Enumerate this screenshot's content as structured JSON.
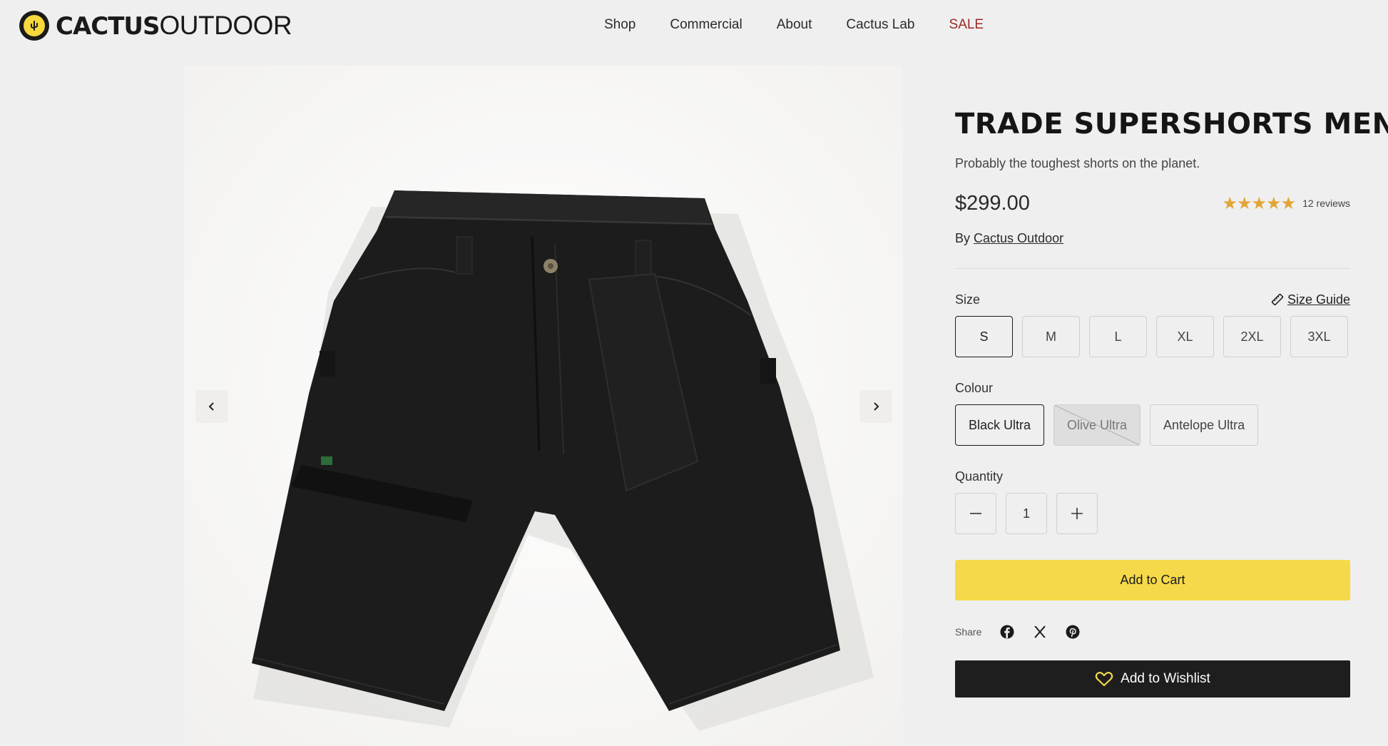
{
  "brand": {
    "bold": "CACTUS",
    "thin": "OUTDOOR"
  },
  "nav": {
    "shop": "Shop",
    "commercial": "Commercial",
    "about": "About",
    "lab": "Cactus Lab",
    "sale": "SALE"
  },
  "product": {
    "title": "TRADE SUPERSHORTS MENS",
    "subtitle": "Probably the toughest shorts on the planet.",
    "price": "$299.00",
    "stars": "★★★★★",
    "rating": 5,
    "reviews": "12 reviews",
    "by_prefix": "By",
    "brand_link": "Cactus Outdoor"
  },
  "size": {
    "label": "Size",
    "guide": "Size Guide",
    "options": [
      "S",
      "M",
      "L",
      "XL",
      "2XL",
      "3XL"
    ],
    "selected": "S"
  },
  "colour": {
    "label": "Colour",
    "options": [
      "Black Ultra",
      "Olive Ultra",
      "Antelope Ultra"
    ],
    "selected": "Black Ultra",
    "unavailable": [
      "Olive Ultra"
    ]
  },
  "quantity": {
    "label": "Quantity",
    "value": "1"
  },
  "actions": {
    "add_to_cart": "Add to Cart",
    "add_to_wishlist": "Add to Wishlist"
  },
  "share": {
    "label": "Share",
    "networks": [
      "facebook-icon",
      "x-icon",
      "pinterest-icon"
    ]
  },
  "colors": {
    "accent_yellow": "#f6d94a",
    "sale_red": "#9b2a2a",
    "star": "#e3a535",
    "dark": "#1e1e1e"
  }
}
